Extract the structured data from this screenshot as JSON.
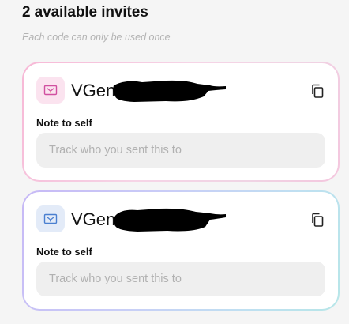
{
  "header": {
    "title": "2 available invites",
    "subtitle": "Each code can only be used once"
  },
  "invites": [
    {
      "code_visible": "VGen",
      "theme": "pink",
      "icon": "ticket-icon",
      "icon_color": "#d14fa0",
      "note_label": "Note to self",
      "note_placeholder": "Track who you sent this to",
      "note_value": ""
    },
    {
      "code_visible": "VGen",
      "theme": "blue",
      "icon": "ticket-icon",
      "icon_color": "#4a7fd0",
      "note_label": "Note to self",
      "note_placeholder": "Track who you sent this to",
      "note_value": ""
    }
  ],
  "colors": {
    "pink_border": "#f4c6de",
    "blue_border": "#c7b9f6",
    "input_bg": "#efefef",
    "redaction": "#000000"
  }
}
